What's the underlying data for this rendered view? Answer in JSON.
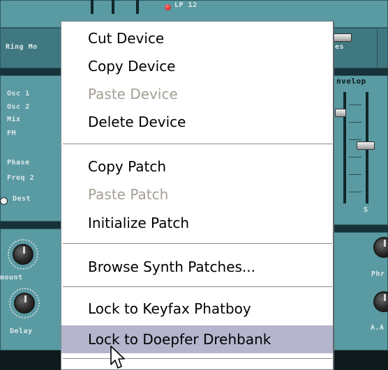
{
  "panel": {
    "top_display": "LP 12",
    "ring_mod": "Ring Mo",
    "mod_dest": [
      "Osc 1",
      "Osc 2",
      "Mix",
      "FM",
      "Phase",
      "Freq 2"
    ],
    "dest_label": "Dest",
    "amount_label": "mount",
    "delay_label": "Delay",
    "right_labels": {
      "es": "es",
      "envelope": "nvelop",
      "s": "S",
      "phr": "Phr",
      "aa": "A.A"
    }
  },
  "menu": {
    "items": [
      {
        "label": "Cut Device",
        "state": "enabled"
      },
      {
        "label": "Copy Device",
        "state": "enabled"
      },
      {
        "label": "Paste Device",
        "state": "disabled"
      },
      {
        "label": "Delete Device",
        "state": "enabled"
      },
      {
        "label": "Copy Patch",
        "state": "enabled"
      },
      {
        "label": "Paste Patch",
        "state": "disabled"
      },
      {
        "label": "Initialize Patch",
        "state": "enabled"
      },
      {
        "label": "Browse Synth Patches...",
        "state": "enabled"
      },
      {
        "label": "Lock to Keyfax Phatboy",
        "state": "enabled"
      },
      {
        "label": "Lock to Doepfer Drehbank",
        "state": "highlighted"
      }
    ]
  },
  "colors": {
    "panel": "#4c8890",
    "menu_bg": "#ffffff",
    "highlight": "#b5b5cd",
    "disabled_text": "#a39f94"
  },
  "icons": {
    "cursor": "arrow-pointer-icon"
  }
}
